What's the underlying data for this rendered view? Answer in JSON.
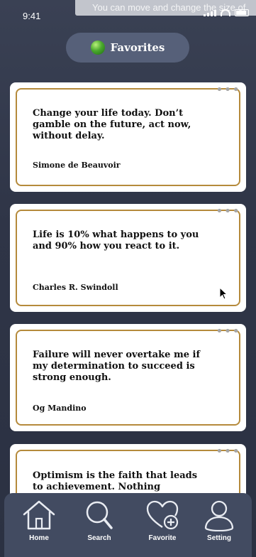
{
  "status_bar": {
    "time": "9:41",
    "notification": "You can move and change the size of"
  },
  "header": {
    "title": "Favorites"
  },
  "quotes": [
    {
      "text": "Change your life today. Don’t gamble on the future, act now, without delay.",
      "author": "Simone de Beauvoir"
    },
    {
      "text": "Life is 10% what happens to you and 90% how you react to it.",
      "author": "Charles R. Swindoll"
    },
    {
      "text": "Failure will never overtake me if my determination to succeed is strong enough.",
      "author": "Og Mandino"
    },
    {
      "text": "Optimism is the faith that leads to achievement.  Nothing",
      "author": ""
    }
  ],
  "more_label": "•••",
  "tab_bar": {
    "items": [
      {
        "label": "Home",
        "icon": "home-icon"
      },
      {
        "label": "Search",
        "icon": "search-icon"
      },
      {
        "label": "Favorite",
        "icon": "heart-plus-icon"
      },
      {
        "label": "Setting",
        "icon": "user-icon"
      }
    ]
  }
}
